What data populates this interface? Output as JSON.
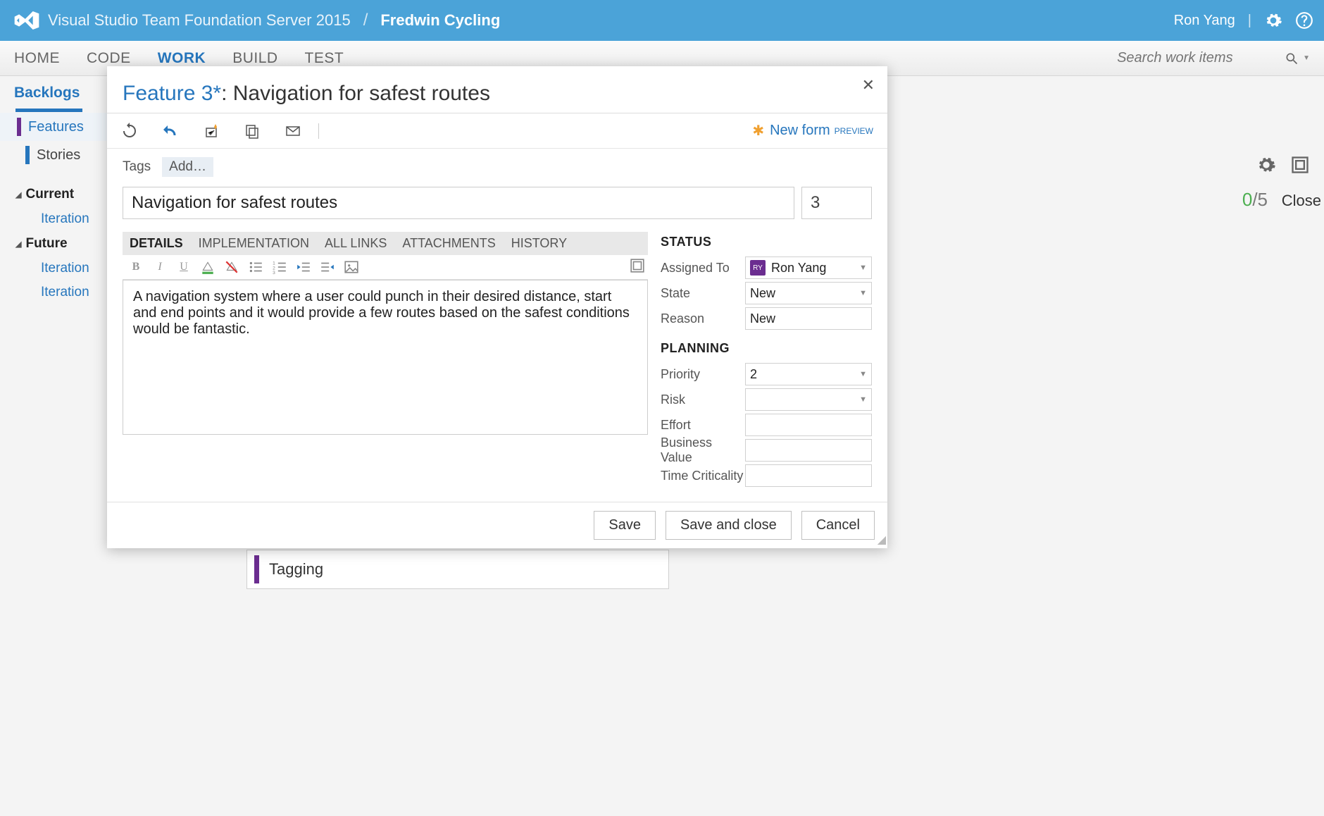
{
  "banner": {
    "product": "Visual Studio Team Foundation Server 2015",
    "project": "Fredwin Cycling",
    "user": "Ron Yang"
  },
  "tabs": {
    "home": "HOME",
    "code": "CODE",
    "work": "WORK",
    "build": "BUILD",
    "test": "TEST"
  },
  "search": {
    "placeholder": "Search work items"
  },
  "subnav": {
    "backlogs": "Backlogs"
  },
  "sidebar": {
    "features": "Features",
    "stories": "Stories",
    "current": "Current",
    "future": "Future",
    "iteration": "Iteration"
  },
  "bgcard": {
    "label": "Tagging"
  },
  "capacity": {
    "used": "0",
    "total": "/5",
    "close": "Close"
  },
  "dialog": {
    "type": "Feature 3*",
    "title_sep": ": ",
    "title": "Navigation for safest routes",
    "newform": "New form",
    "preview": "PREVIEW",
    "tags_label": "Tags",
    "add": "Add…",
    "id": "3",
    "desc": "A navigation system where a user could punch in their desired distance, start and end points and it would provide a few routes based on the safest conditions would be fantastic.",
    "dtabs": {
      "details": "DETAILS",
      "impl": "IMPLEMENTATION",
      "links": "ALL LINKS",
      "attach": "ATTACHMENTS",
      "history": "HISTORY"
    },
    "sections": {
      "status": "STATUS",
      "planning": "PLANNING"
    },
    "fields": {
      "assigned_to_label": "Assigned To",
      "assigned_to_value": "Ron Yang",
      "avatar_initials": "RY",
      "state_label": "State",
      "state_value": "New",
      "reason_label": "Reason",
      "reason_value": "New",
      "priority_label": "Priority",
      "priority_value": "2",
      "risk_label": "Risk",
      "risk_value": "",
      "effort_label": "Effort",
      "effort_value": "",
      "bv_label": "Business Value",
      "bv_value": "",
      "tc_label": "Time Criticality",
      "tc_value": ""
    },
    "buttons": {
      "save": "Save",
      "save_close": "Save and close",
      "cancel": "Cancel"
    }
  }
}
